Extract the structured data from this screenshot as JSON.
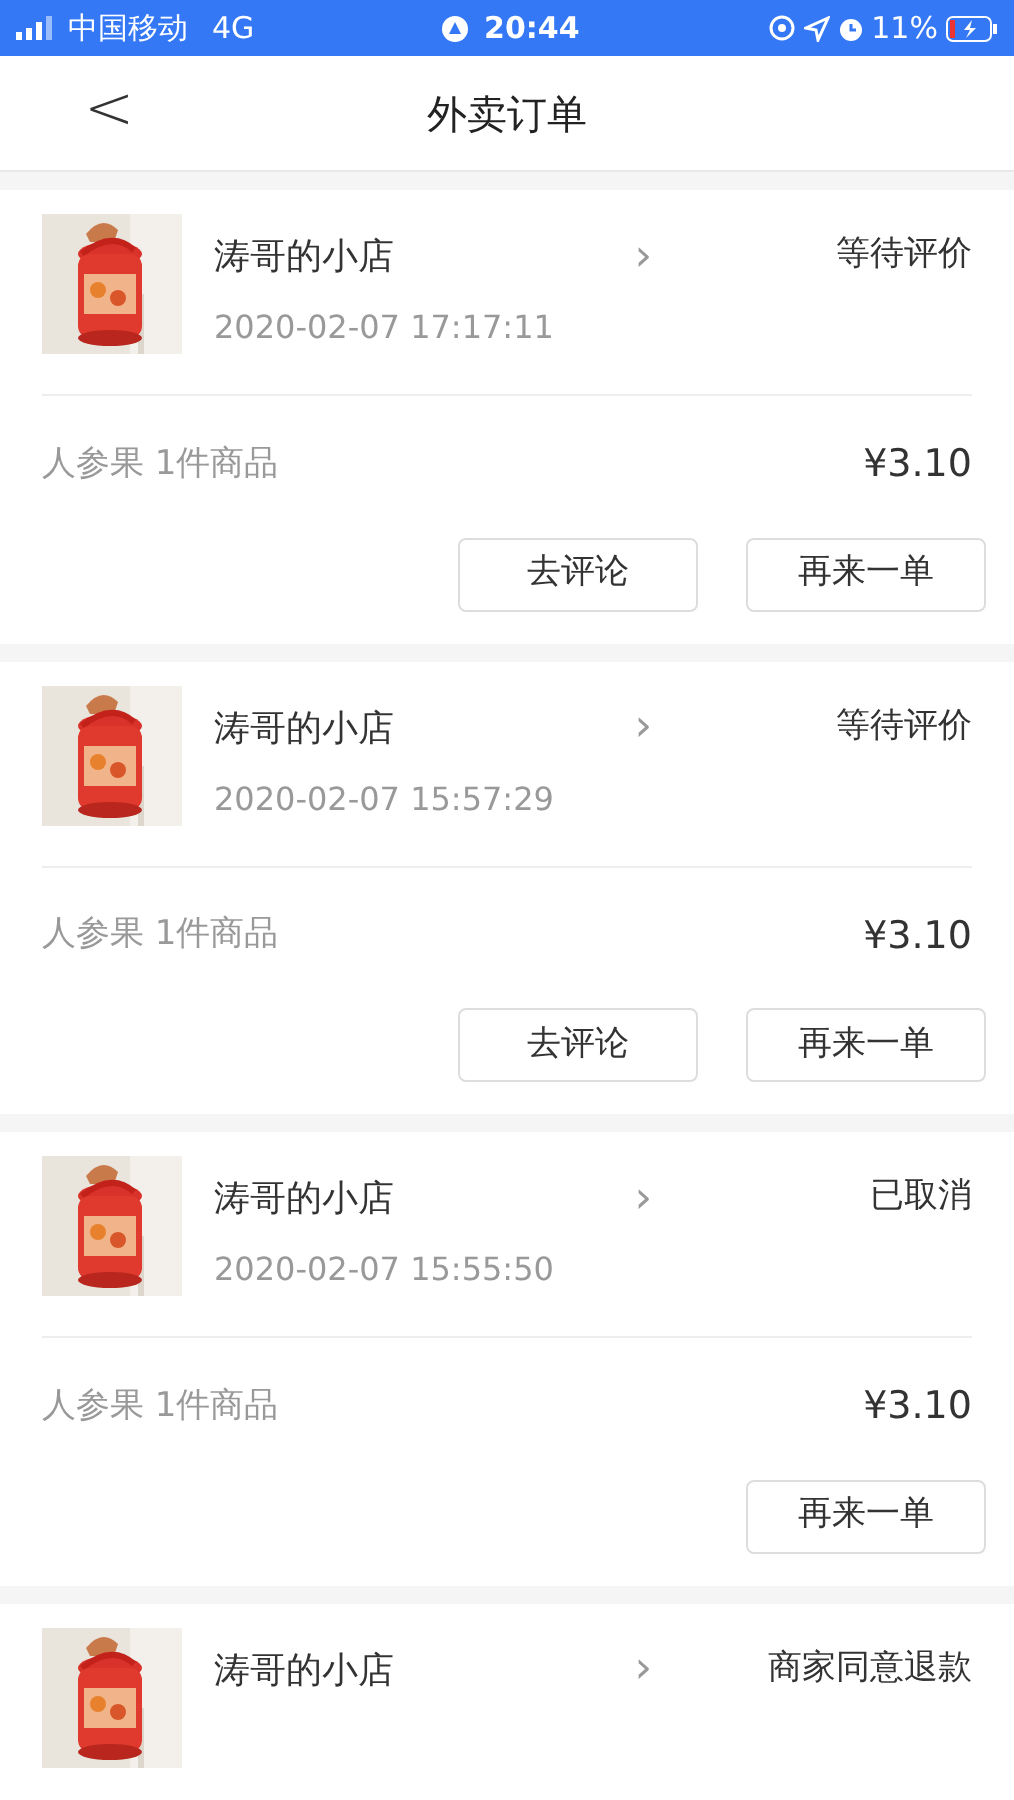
{
  "status_bar": {
    "carrier": "中国移动",
    "network": "4G",
    "time": "20:44",
    "battery": "11%"
  },
  "nav": {
    "back": "<",
    "title": "外卖订单"
  },
  "orders": [
    {
      "shop": "涛哥的小店",
      "arrow": "›",
      "date": "2020-02-07 17:17:11",
      "status": "等待评价",
      "goods": "人参果 1件商品",
      "price": "¥3.10",
      "buttons": [
        "去评论",
        "再来一单"
      ]
    },
    {
      "shop": "涛哥的小店",
      "arrow": "›",
      "date": "2020-02-07 15:57:29",
      "status": "等待评价",
      "goods": "人参果 1件商品",
      "price": "¥3.10",
      "buttons": [
        "去评论",
        "再来一单"
      ]
    },
    {
      "shop": "涛哥的小店",
      "arrow": "›",
      "date": "2020-02-07 15:55:50",
      "status": "已取消",
      "goods": "人参果 1件商品",
      "price": "¥3.10",
      "buttons": [
        "再来一单"
      ]
    },
    {
      "shop": "涛哥的小店",
      "arrow": "›",
      "status": "商家同意退款"
    }
  ]
}
